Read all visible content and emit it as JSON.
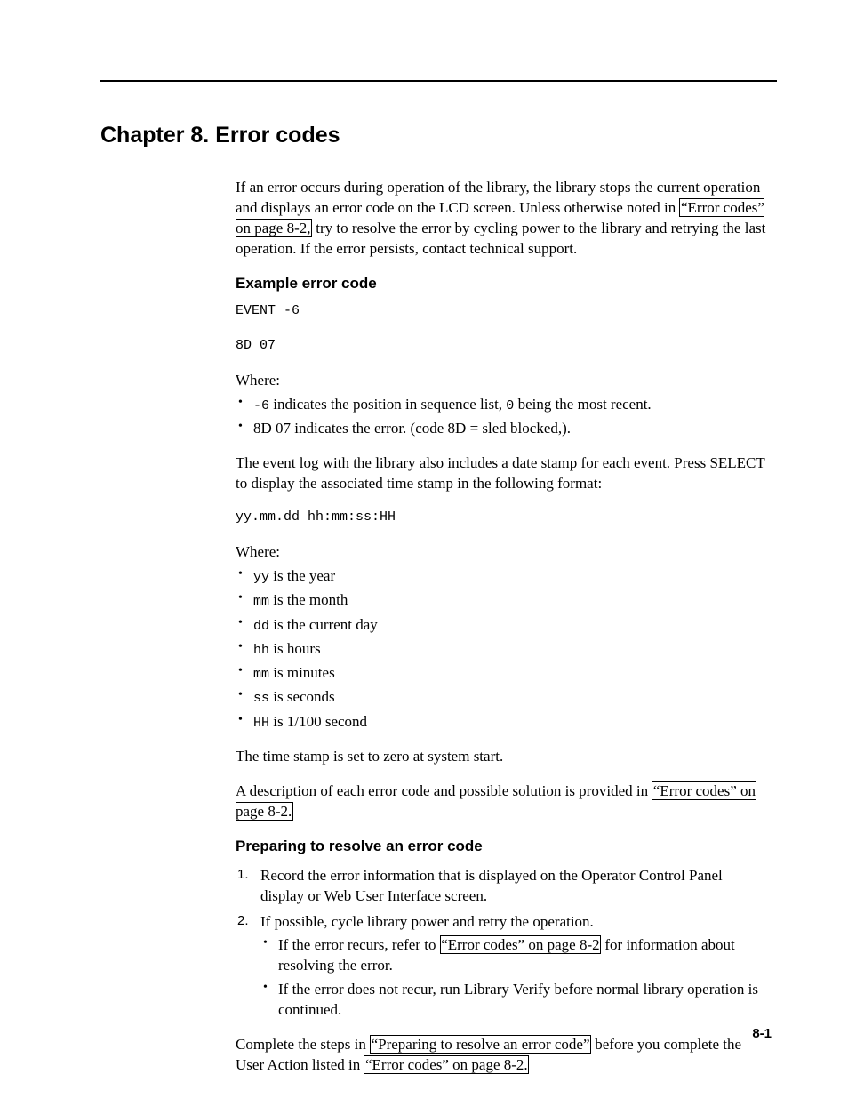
{
  "chapter_title": "Chapter 8. Error codes",
  "intro": {
    "p1_part1": "If an error occurs during operation of the library, the library stops the current operation and displays an error code on the LCD screen. Unless otherwise noted in ",
    "link1": "“Error codes” on page 8-2,",
    "p1_part2": " try to resolve the error by cycling power to the library and retrying the last operation. If the error persists, contact technical support."
  },
  "example": {
    "title": "Example error code",
    "code1": "EVENT -6",
    "code2": "8D 07",
    "where": "Where:",
    "b1_code": "-6",
    "b1_rest": " indicates the position in sequence list, ",
    "b1_code2": "0",
    "b1_rest2": " being the most recent.",
    "b2": "8D 07 indicates the error. (code 8D = sled blocked,).",
    "p2": "The event log with the library also includes a date stamp for each event. Press SELECT to display the associated time stamp in the following format:",
    "code3": "yy.mm.dd hh:mm:ss:HH",
    "where2": "Where:",
    "ts": {
      "yy_code": "yy",
      "yy_rest": " is the year",
      "mm_code": "mm",
      "mm_rest": " is the month",
      "dd_code": "dd",
      "dd_rest": " is the current day",
      "hh_code": "hh",
      "hh_rest": " is hours",
      "mm2_code": "mm",
      "mm2_rest": " is minutes",
      "ss_code": "ss",
      "ss_rest": " is seconds",
      "HH_code": "HH",
      "HH_rest": " is 1/100 second"
    },
    "p3": "The time stamp is set to zero at system start.",
    "p4_part1": "A description of each error code and possible solution is provided in ",
    "p4_link": "“Error codes” on page 8-2.",
    "p4_part2": ""
  },
  "prep": {
    "title": "Preparing to resolve an error code",
    "n1": "Record the error information that is displayed on the Operator Control Panel display or Web User Interface screen.",
    "n2": "If possible, cycle library power and retry the operation.",
    "n2_b1_part1": "If the error recurs, refer to ",
    "n2_b1_link": "“Error codes” on page 8-2",
    "n2_b1_part2": " for information about resolving the error.",
    "n2_b2": "If the error does not recur, run Library Verify before normal library operation is continued.",
    "closing_part1": "Complete the steps in ",
    "closing_link1": "“Preparing to resolve an error code”",
    "closing_part2": " before you complete the User Action listed in ",
    "closing_link2": "“Error codes” on page 8-2.",
    "closing_part3": ""
  },
  "page_number": "8-1"
}
